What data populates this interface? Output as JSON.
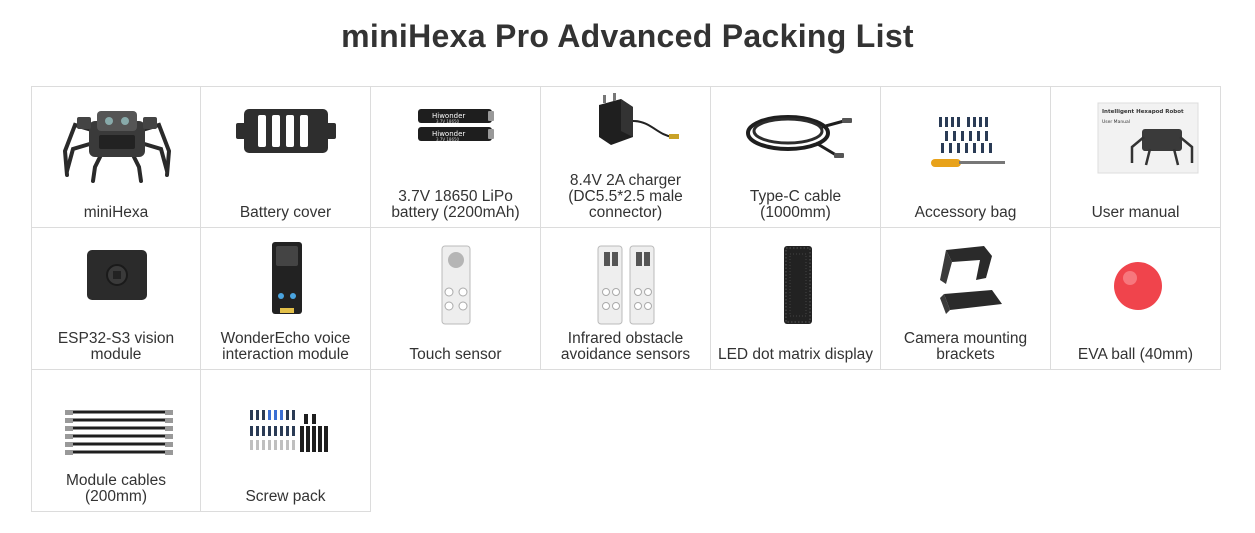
{
  "title": "miniHexa Pro Advanced Packing List",
  "items": [
    {
      "label": "miniHexa",
      "icon": "hexapod-robot-icon"
    },
    {
      "label": "Battery cover",
      "icon": "battery-cover-icon"
    },
    {
      "label": "3.7V 18650 LiPo battery (2200mAh)",
      "icon": "battery-cells-icon",
      "print": "Hiwonder",
      "spec": "3.7V 18650"
    },
    {
      "label": "8.4V 2A charger (DC5.5*2.5 male connector)",
      "icon": "charger-icon"
    },
    {
      "label": "Type-C cable (1000mm)",
      "icon": "type-c-cable-icon"
    },
    {
      "label": "Accessory bag",
      "icon": "accessory-bag-icon"
    },
    {
      "label": "User manual",
      "icon": "user-manual-icon",
      "cover_title": "Intelligent Hexapod Robot",
      "cover_sub": "User Manual"
    },
    {
      "label": "ESP32-S3 vision module",
      "icon": "vision-module-icon"
    },
    {
      "label": "WonderEcho voice interaction module",
      "icon": "voice-module-icon"
    },
    {
      "label": "Touch sensor",
      "icon": "touch-sensor-icon"
    },
    {
      "label": "Infrared obstacle avoidance sensors",
      "icon": "infrared-sensor-icon"
    },
    {
      "label": "LED dot matrix display",
      "icon": "led-matrix-icon"
    },
    {
      "label": "Camera mounting brackets",
      "icon": "camera-bracket-icon"
    },
    {
      "label": "EVA ball (40mm)",
      "icon": "eva-ball-icon"
    },
    {
      "label": "Module cables (200mm)",
      "icon": "module-cables-icon"
    },
    {
      "label": "Screw pack",
      "icon": "screw-pack-icon"
    }
  ]
}
